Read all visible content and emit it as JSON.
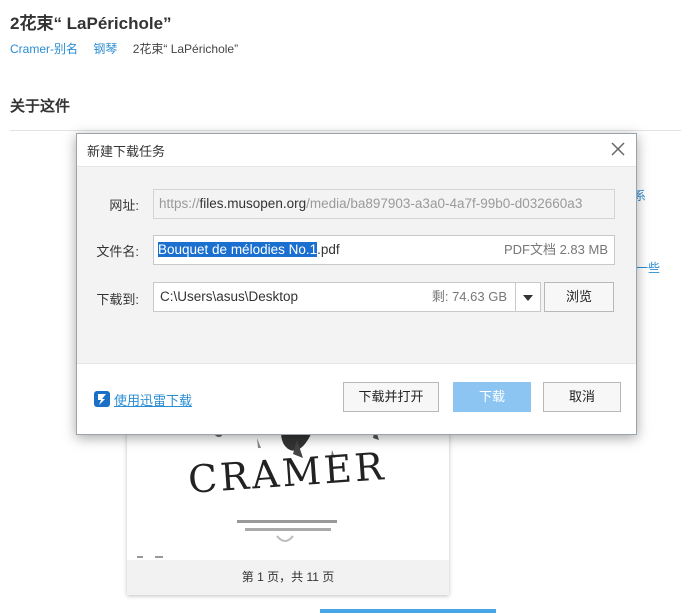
{
  "page": {
    "title": "2花束“ LaPérichole”",
    "breadcrumb": [
      "Cramer-别名",
      "钢琴",
      "2花束“ LaPérichole”"
    ],
    "section_title": "关于这件",
    "side_links": [
      "系",
      "一些"
    ]
  },
  "preview": {
    "sheet_title": "CRAMER",
    "page_info": "第 1 页，共 11 页"
  },
  "dialog": {
    "title": "新建下载任务",
    "url": {
      "label": "网址:",
      "prefix": "https://",
      "host": "files.musopen.org",
      "path": "/media/ba897903-a3a0-4a7f-99b0-d032660a3"
    },
    "filename": {
      "label": "文件名:",
      "name_selected": "Bouquet de mélodies No.1",
      "extension": ".pdf",
      "meta": "PDF文档 2.83 MB"
    },
    "save_to": {
      "label": "下载到:",
      "path": "C:\\Users\\asus\\Desktop",
      "free_space": "剩: 74.63 GB",
      "browse_label": "浏览"
    },
    "xunlei_link": "使用迅雷下载",
    "buttons": {
      "download_open": "下载并打开",
      "download": "下载",
      "cancel": "取消"
    }
  },
  "colors": {
    "link": "#2a8dd4",
    "primary_button": "#8cc5f2",
    "selection": "#1a6fcf"
  }
}
